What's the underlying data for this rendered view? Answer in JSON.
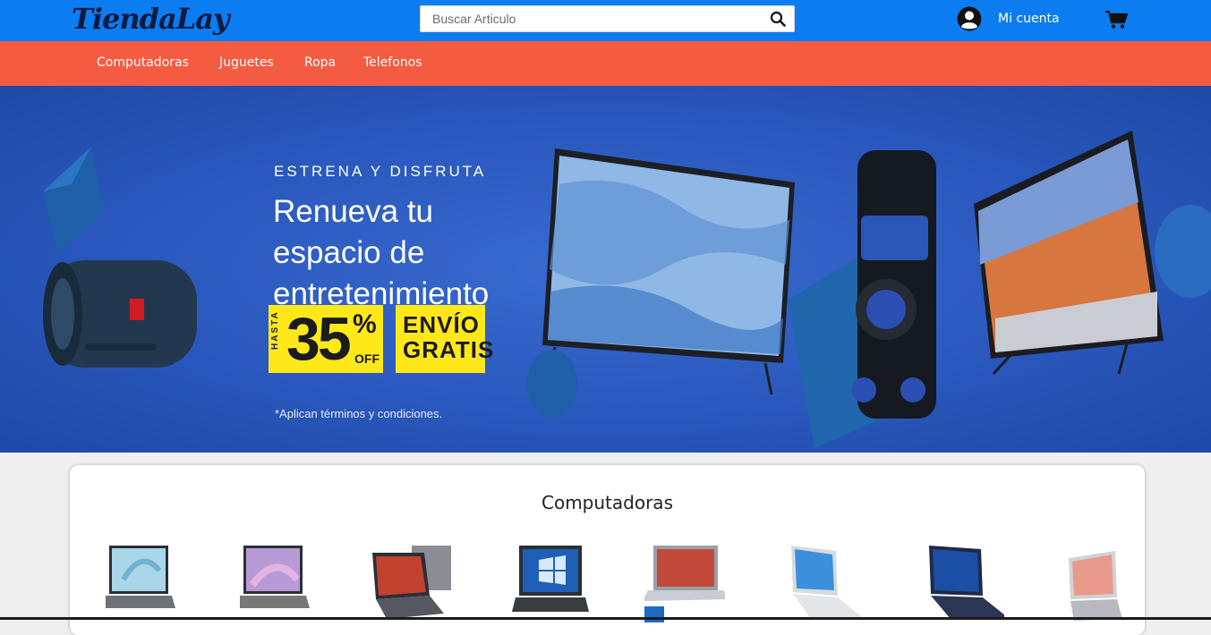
{
  "header": {
    "logo_text": "TiendaLay",
    "search_placeholder": "Buscar Articulo",
    "account_label": "Mi cuenta"
  },
  "categories": [
    "Computadoras",
    "Juguetes",
    "Ropa",
    "Telefonos"
  ],
  "banner": {
    "kicker": "ESTRENA Y DISFRUTA",
    "headline": "Renueva tu espacio de entretenimiento",
    "promo_prefix": "HASTA",
    "promo_value": "35",
    "promo_symbol": "%",
    "promo_off": "OFF",
    "promo_free": "ENVÍO GRATIS",
    "terms": "*Aplican términos y condiciones."
  },
  "products_section": {
    "title": "Computadoras"
  },
  "colors": {
    "header_blue": "#0c7cf1",
    "category_orange": "#f55b40",
    "promo_yellow": "#ffe81a",
    "banner_blue": "#2a58bd"
  },
  "icons": {
    "search": "search-icon",
    "account": "user-avatar-icon",
    "cart": "shopping-cart-icon"
  }
}
